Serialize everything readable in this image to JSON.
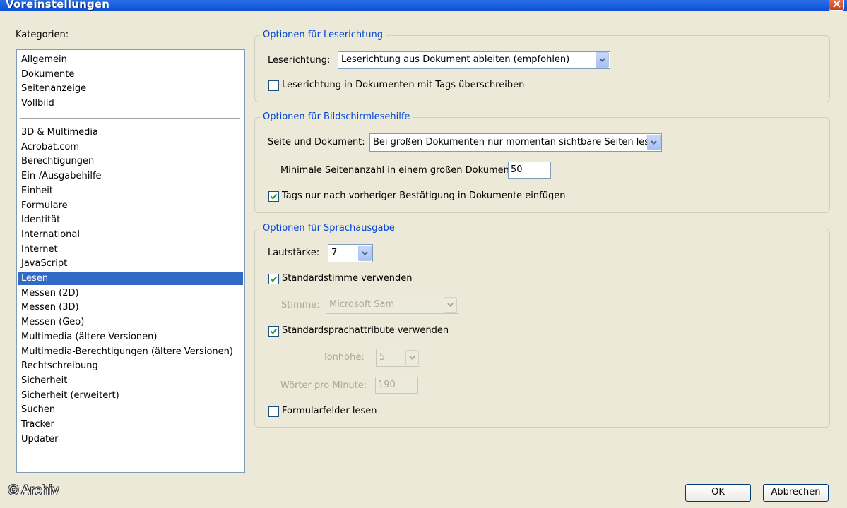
{
  "window": {
    "title": "Voreinstellungen"
  },
  "categories": {
    "label": "Kategorien:",
    "group1": [
      "Allgemein",
      "Dokumente",
      "Seitenanzeige",
      "Vollbild"
    ],
    "group2": [
      "3D & Multimedia",
      "Acrobat.com",
      "Berechtigungen",
      "Ein-/Ausgabehilfe",
      "Einheit",
      "Formulare",
      "Identität",
      "International",
      "Internet",
      "JavaScript",
      "Lesen",
      "Messen (2D)",
      "Messen (3D)",
      "Messen (Geo)",
      "Multimedia (ältere Versionen)",
      "Multimedia-Berechtigungen (ältere Versionen)",
      "Rechtschreibung",
      "Sicherheit",
      "Sicherheit (erweitert)",
      "Suchen",
      "Tracker",
      "Updater"
    ],
    "selected": "Lesen"
  },
  "reading_order": {
    "title": "Optionen für Leserichtung",
    "label": "Leserichtung:",
    "value": "Leserichtung aus Dokument ableiten (empfohlen)",
    "override_label": "Leserichtung in Dokumenten mit Tags überschreiben",
    "override_checked": false
  },
  "screen_reader": {
    "title": "Optionen für Bildschirmlesehilfe",
    "page_doc_label": "Seite und Dokument:",
    "page_doc_value": "Bei großen Dokumenten nur momentan sichtbare Seiten lesen",
    "min_pages_label": "Minimale Seitenanzahl in einem großen Dokument:",
    "min_pages_value": "50",
    "confirm_tags_label": "Tags nur nach vorheriger Bestätigung in Dokumente einfügen",
    "confirm_tags_checked": true
  },
  "speech": {
    "title": "Optionen für Sprachausgabe",
    "volume_label": "Lautstärke:",
    "volume_value": "7",
    "default_voice_label": "Standardstimme verwenden",
    "default_voice_checked": true,
    "voice_label": "Stimme:",
    "voice_value": "Microsoft Sam",
    "default_attrs_label": "Standardsprachattribute verwenden",
    "default_attrs_checked": true,
    "pitch_label": "Tonhöhe:",
    "pitch_value": "5",
    "wpm_label": "Wörter pro Minute:",
    "wpm_value": "190",
    "read_forms_label": "Formularfelder lesen",
    "read_forms_checked": false
  },
  "buttons": {
    "ok": "OK",
    "cancel": "Abbrechen"
  },
  "watermark": "© Archiv"
}
